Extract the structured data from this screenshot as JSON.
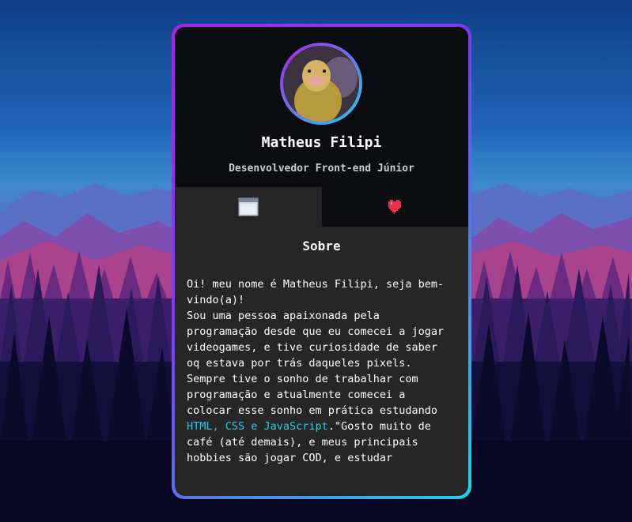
{
  "profile": {
    "name": "Matheus Filipi",
    "role": "Desenvolvedor Front-end Júnior",
    "avatar_icon": "duck-photo"
  },
  "tabs": [
    {
      "icon": "browser-window-icon",
      "active": true
    },
    {
      "icon": "heart-icon",
      "active": false
    }
  ],
  "section": {
    "title": "Sobre",
    "text_before": "Oi! meu nome é Matheus Filipi, seja bem-\nvindo(a)!\nSou uma pessoa apaixonada pela\nprogramação desde que eu comecei a jogar\nvideogames, e tive curiosidade de saber\noq estava por trás daqueles pixels.\nSempre tive o sonho de trabalhar com\nprogramação e atualmente comecei a\ncolocar esse sonho em prática estudando\n",
    "highlight": "HTML, CSS e JavaScript",
    "text_after": ".\"Gosto muito de\ncafé (até demais), e meus principais\nhobbies são jogar COD, e estudar"
  },
  "colors": {
    "accent_purple": "#b11ef0",
    "accent_cyan": "#1fd0ea",
    "card_bg": "#262626",
    "header_bg": "#0a0c0f",
    "heart_red": "#e8304a"
  }
}
